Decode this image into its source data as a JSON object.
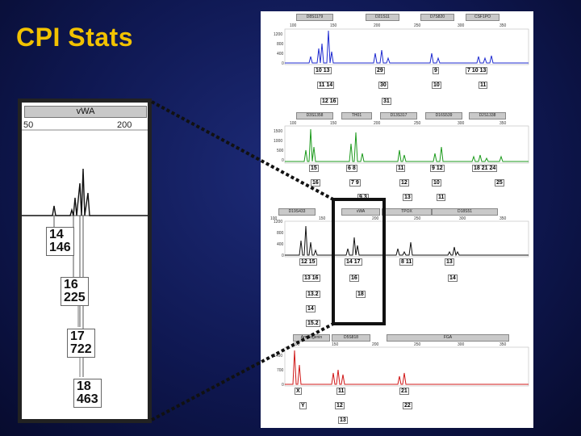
{
  "title": "CPI Stats",
  "zoom": {
    "locus": "vWA",
    "axis_ticks": [
      "50",
      "200"
    ],
    "labels": [
      {
        "a": "14",
        "b": "146"
      },
      {
        "a": "16",
        "b": "225"
      },
      {
        "a": "17",
        "b": "722"
      },
      {
        "a": "18",
        "b": "463"
      }
    ]
  },
  "panels": [
    {
      "headers": [
        "D8S1179",
        "D21S11",
        "D7S820",
        "CSF1PO"
      ],
      "xticks": [
        "100",
        "150",
        "200",
        "250",
        "300",
        "350"
      ],
      "yticks": [
        "1200",
        "800",
        "400",
        "0"
      ],
      "rows": [
        [
          "10",
          "13",
          "29",
          "9",
          "7",
          "10",
          "13"
        ],
        [
          "11",
          "14",
          "30",
          "10",
          "11"
        ],
        [
          "12",
          "16",
          "31"
        ]
      ]
    },
    {
      "headers": [
        "D3S1358",
        "TH01",
        "D13S317",
        "D16S539",
        "D2S1338"
      ],
      "xticks": [
        "100",
        "150",
        "200",
        "250",
        "300",
        "350"
      ],
      "yticks": [
        "1500",
        "1000",
        "500",
        "0"
      ],
      "rows": [
        [
          "15",
          "6",
          "8",
          "11",
          "9",
          "12",
          "18",
          "21",
          "24"
        ],
        [
          "16",
          "7",
          "9",
          "12",
          "10",
          "25"
        ],
        [
          "9.3",
          "13",
          "11"
        ]
      ]
    },
    {
      "headers": [
        "D19S433",
        "vWA",
        "TPOX",
        "D18S51"
      ],
      "xticks": [
        "100",
        "150",
        "200",
        "250",
        "300",
        "350"
      ],
      "yticks": [
        "1200",
        "800",
        "400",
        "0"
      ],
      "rows": [
        [
          "12",
          "15",
          "14",
          "17",
          "8",
          "11",
          "13"
        ],
        [
          "13",
          "16",
          "16",
          "14"
        ],
        [
          "13.2",
          "18"
        ],
        [
          "14"
        ],
        [
          "15.2"
        ]
      ]
    },
    {
      "headers": [
        "Amelogenin",
        "D5S818",
        "FGA"
      ],
      "xticks": [
        "100",
        "150",
        "200",
        "250",
        "300",
        "350"
      ],
      "yticks": [
        "1400",
        "700",
        "0"
      ],
      "rows": [
        [
          "X",
          "11",
          "21"
        ],
        [
          "Y",
          "12",
          "22"
        ],
        [
          "13"
        ]
      ]
    }
  ],
  "colors": {
    "title": "#f2c200",
    "blue_dye": "#1f2bd0",
    "green_dye": "#1c9a1c",
    "black_dye": "#111111",
    "red_dye": "#d01818"
  }
}
